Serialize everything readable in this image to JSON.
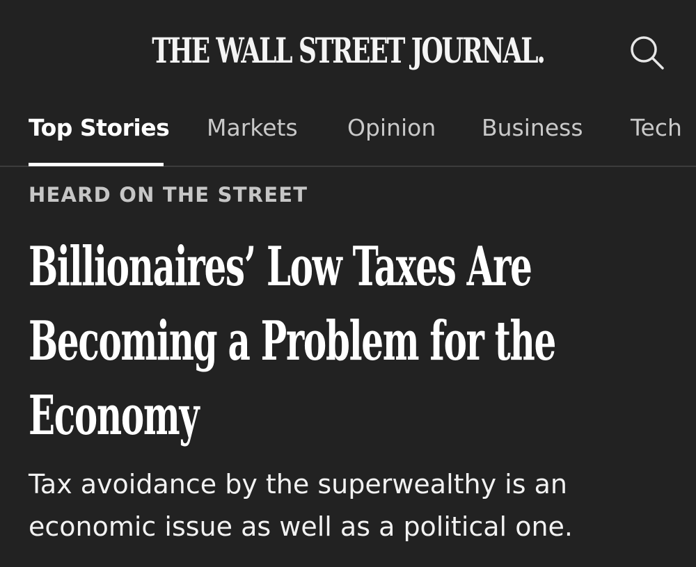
{
  "masthead": {
    "title": "THE WALL STREET JOURNAL.",
    "search_icon": "search-icon"
  },
  "nav": {
    "tabs": [
      {
        "label": "Top Stories",
        "active": true
      },
      {
        "label": "Markets",
        "active": false
      },
      {
        "label": "Opinion",
        "active": false
      },
      {
        "label": "Business",
        "active": false
      },
      {
        "label": "Tech",
        "active": false
      }
    ]
  },
  "article": {
    "kicker": "HEARD ON THE STREET",
    "headline": "Billionaires’ Low Taxes Are Becoming a Problem for the Economy",
    "dek": "Tax avoidance by the superwealthy is an economic issue as well as a political one."
  },
  "colors": {
    "background": "#222222",
    "text": "#ffffff",
    "muted_text": "#c9c9c9",
    "divider": "#3c3c3c"
  }
}
